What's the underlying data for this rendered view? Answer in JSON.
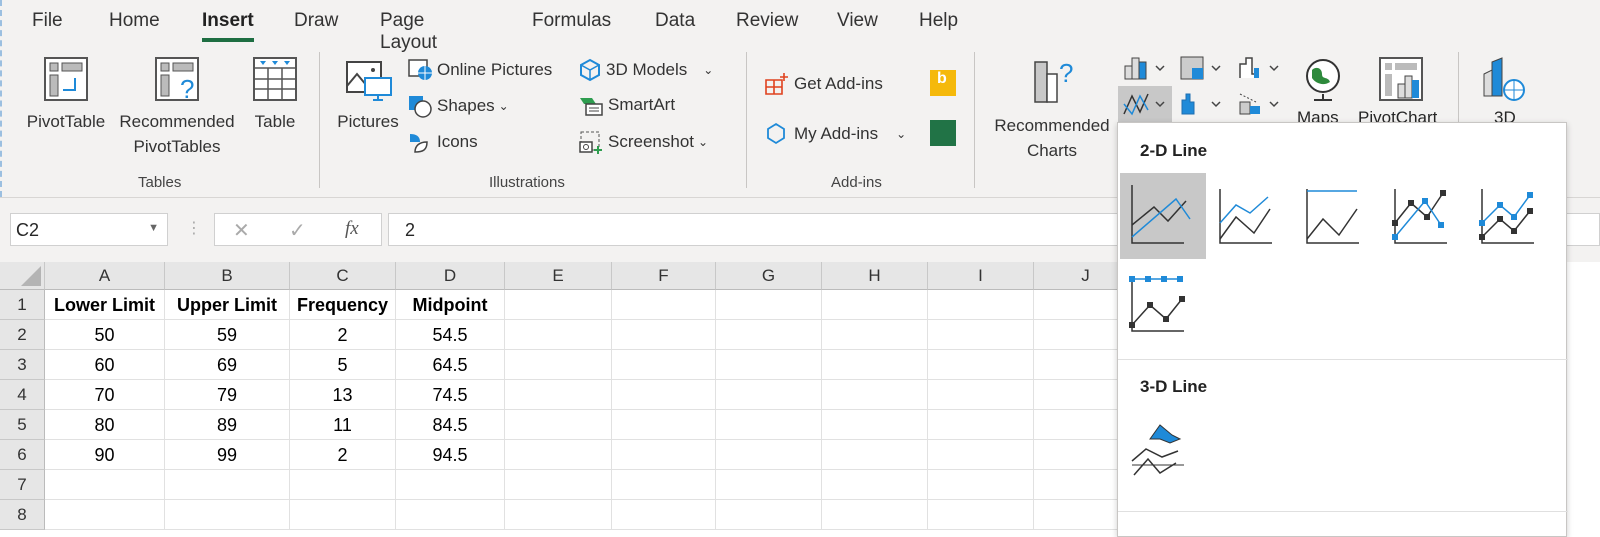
{
  "tabs": [
    "File",
    "Home",
    "Insert",
    "Draw",
    "Page Layout",
    "Formulas",
    "Data",
    "Review",
    "View",
    "Help"
  ],
  "active_tab": "Insert",
  "ribbon": {
    "tables": {
      "label": "Tables",
      "pivottable": "PivotTable",
      "recommended_pivot_1": "Recommended",
      "recommended_pivot_2": "PivotTables",
      "table": "Table"
    },
    "illustrations": {
      "label": "Illustrations",
      "pictures": "Pictures",
      "online_pictures": "Online Pictures",
      "shapes": "Shapes",
      "icons": "Icons",
      "models": "3D Models",
      "smartart": "SmartArt",
      "screenshot": "Screenshot"
    },
    "addins": {
      "label": "Add-ins",
      "get": "Get Add-ins",
      "my": "My Add-ins"
    },
    "charts": {
      "recommended_1": "Recommended",
      "recommended_2": "Charts",
      "maps": "Maps",
      "pivotchart": "PivotChart",
      "map3d": "3D"
    }
  },
  "formula_bar": {
    "name_box": "C2",
    "cancel": "✕",
    "enter": "✓",
    "fx": "fx",
    "value": "2"
  },
  "columns": [
    "A",
    "B",
    "C",
    "D",
    "E",
    "F",
    "G",
    "H",
    "I",
    "J"
  ],
  "rows": [
    "1",
    "2",
    "3",
    "4",
    "5",
    "6",
    "7",
    "8"
  ],
  "cells": [
    [
      "Lower Limit",
      "Upper Limit",
      "Frequency",
      "Midpoint"
    ],
    [
      "50",
      "59",
      "2",
      "54.5"
    ],
    [
      "60",
      "69",
      "5",
      "64.5"
    ],
    [
      "70",
      "79",
      "13",
      "74.5"
    ],
    [
      "80",
      "89",
      "11",
      "84.5"
    ],
    [
      "90",
      "99",
      "2",
      "94.5"
    ]
  ],
  "dropdown": {
    "section_2d": "2-D Line",
    "section_3d": "3-D Line",
    "selected_option": 0
  },
  "colors": {
    "accent": "#1e6e42",
    "blue": "#1f8ad8",
    "dark": "#333333"
  }
}
